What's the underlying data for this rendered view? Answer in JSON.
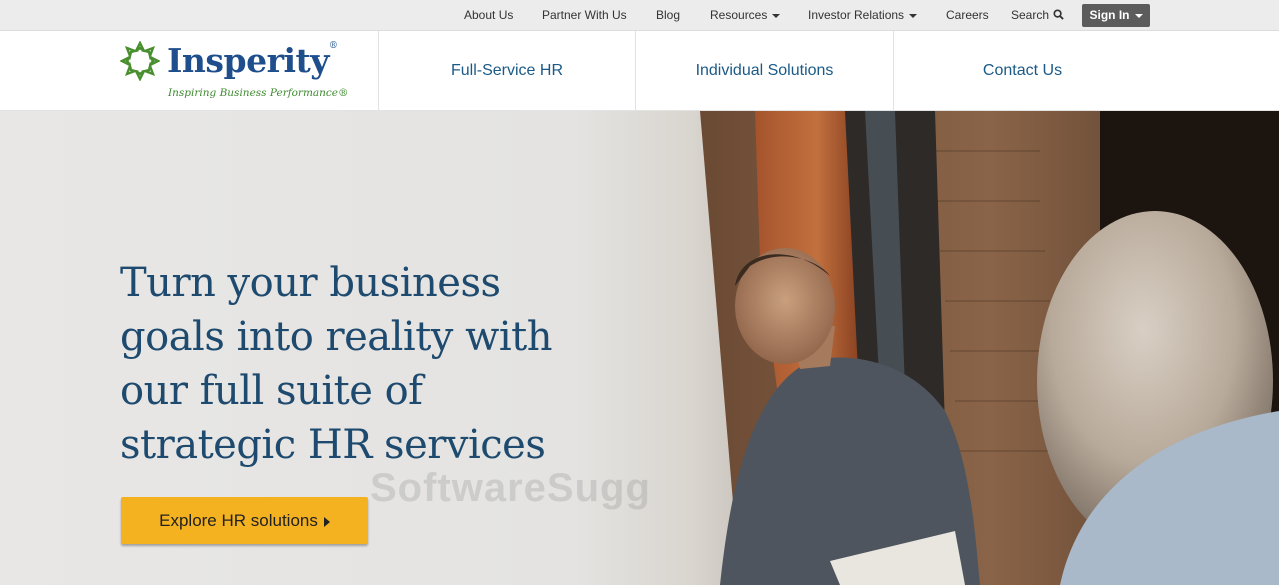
{
  "utility_nav": {
    "about": "About Us",
    "partner": "Partner With Us",
    "blog": "Blog",
    "resources": "Resources",
    "investor": "Investor Relations",
    "careers": "Careers",
    "search": "Search",
    "sign_in": "Sign In"
  },
  "brand": {
    "name": "Insperity",
    "reg": "®",
    "tagline": "Inspiring Business Performance®"
  },
  "main_nav": [
    "Full-Service HR",
    "Individual Solutions",
    "Contact Us"
  ],
  "hero": {
    "headline": "Turn your business goals into reality with our full suite of strategic HR services",
    "cta": "Explore HR solutions",
    "watermark": "SoftwareSugg"
  },
  "icons": {
    "search": "search-icon",
    "caret": "caret-down-icon",
    "cta_arrow": "caret-right-icon",
    "logo_mark": "star-mark-icon"
  },
  "colors": {
    "brand_blue": "#1f4e8c",
    "brand_green": "#3e8a2f",
    "nav_link": "#1b5a87",
    "headline": "#1d4a6e",
    "cta": "#f4b120",
    "sign_in_bg": "#5c5c5c"
  }
}
